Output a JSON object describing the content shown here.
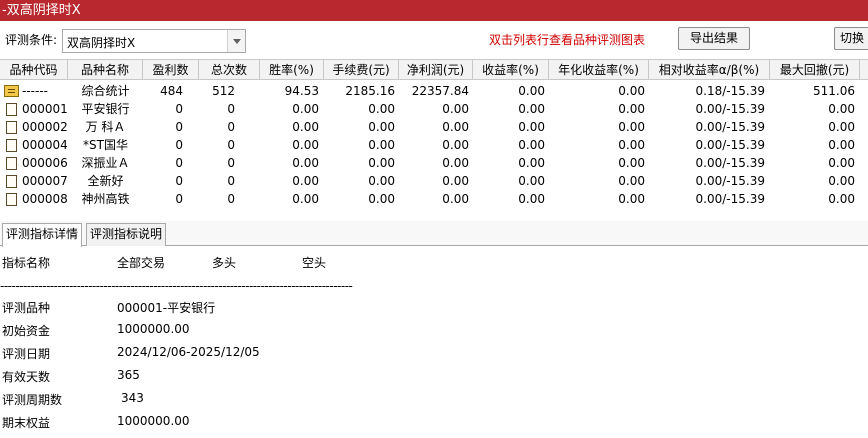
{
  "window": {
    "title": "-双高阴择时X"
  },
  "toolbar": {
    "condition_label": "评测条件:",
    "condition_value": "双高阴择时X",
    "hint": "双击列表行查看品种评测图表",
    "export_label": "导出结果",
    "switch_label": "切换到"
  },
  "grid": {
    "headers": [
      "品种代码",
      "品种名称",
      "盈利数",
      "总次数",
      "胜率(%)",
      "手续费(元)",
      "净利润(元)",
      "收益率(%)",
      "年化收益率(%)",
      "相对收益率α/β(%)",
      "最大回撤(元)"
    ],
    "rows": [
      {
        "icon": "summary-icon",
        "code": "------",
        "name": "综合统计",
        "win": "484",
        "total": "512",
        "winrate": "94.53",
        "fee": "2185.16",
        "profit": "22357.84",
        "ret": "0.00",
        "annual": "0.00",
        "relative": "0.18/-15.39",
        "drawdown": "511.06"
      },
      {
        "icon": "document-icon",
        "code": "000001",
        "name": "平安银行",
        "win": "0",
        "total": "0",
        "winrate": "0.00",
        "fee": "0.00",
        "profit": "0.00",
        "ret": "0.00",
        "annual": "0.00",
        "relative": "0.00/-15.39",
        "drawdown": "0.00"
      },
      {
        "icon": "document-icon",
        "code": "000002",
        "name": "万 科Ａ",
        "win": "0",
        "total": "0",
        "winrate": "0.00",
        "fee": "0.00",
        "profit": "0.00",
        "ret": "0.00",
        "annual": "0.00",
        "relative": "0.00/-15.39",
        "drawdown": "0.00"
      },
      {
        "icon": "document-icon",
        "code": "000004",
        "name": "*ST国华",
        "win": "0",
        "total": "0",
        "winrate": "0.00",
        "fee": "0.00",
        "profit": "0.00",
        "ret": "0.00",
        "annual": "0.00",
        "relative": "0.00/-15.39",
        "drawdown": "0.00"
      },
      {
        "icon": "document-icon",
        "code": "000006",
        "name": "深振业Ａ",
        "win": "0",
        "total": "0",
        "winrate": "0.00",
        "fee": "0.00",
        "profit": "0.00",
        "ret": "0.00",
        "annual": "0.00",
        "relative": "0.00/-15.39",
        "drawdown": "0.00"
      },
      {
        "icon": "document-icon",
        "code": "000007",
        "name": "全新好",
        "win": "0",
        "total": "0",
        "winrate": "0.00",
        "fee": "0.00",
        "profit": "0.00",
        "ret": "0.00",
        "annual": "0.00",
        "relative": "0.00/-15.39",
        "drawdown": "0.00"
      },
      {
        "icon": "document-icon",
        "code": "000008",
        "name": "神州高铁",
        "win": "0",
        "total": "0",
        "winrate": "0.00",
        "fee": "0.00",
        "profit": "0.00",
        "ret": "0.00",
        "annual": "0.00",
        "relative": "0.00/-15.39",
        "drawdown": "0.00"
      }
    ]
  },
  "tabs": [
    {
      "label": "评测指标详情",
      "active": true
    },
    {
      "label": "评测指标说明",
      "active": false
    }
  ],
  "detail": {
    "headers": [
      "指标名称",
      "全部交易",
      "多头",
      "空头"
    ],
    "separator": "--------------------------------------------------------------------------------------------",
    "items": [
      {
        "label": "评测品种",
        "value": "000001-平安银行"
      },
      {
        "label": "初始资金",
        "value": "1000000.00"
      },
      {
        "label": "评测日期",
        "value": "2024/12/06-2025/12/05"
      },
      {
        "label": "有效天数",
        "value": "365"
      },
      {
        "label": "评测周期数",
        "value": "343"
      },
      {
        "label": "期末权益",
        "value": "1000000.00"
      }
    ]
  },
  "colors": {
    "titlebar": "#b8282e",
    "hint": "#d00000"
  }
}
